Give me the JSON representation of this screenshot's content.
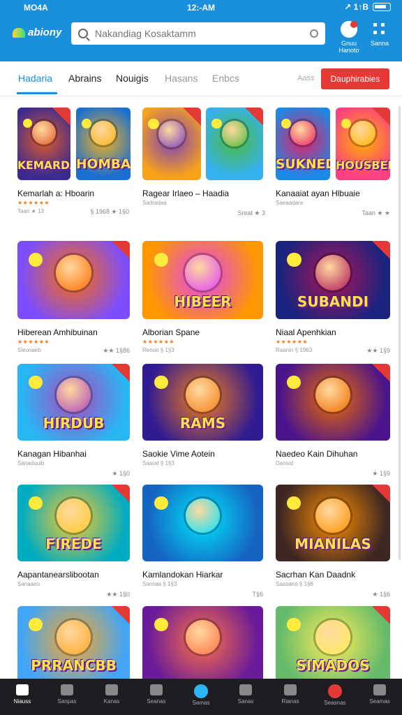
{
  "status": {
    "carrier": "MO4A",
    "time": "12:-AM",
    "signal": "↗︎ 1↑B"
  },
  "header": {
    "logo": "abiony",
    "search_placeholder": "Nakandiag Kosaktamm",
    "notifications_label": "Gnuu\nHanoto",
    "menu_label": "Sanna"
  },
  "tabs": [
    {
      "label": "Hadaria"
    },
    {
      "label": "Abrains"
    },
    {
      "label": "Nouigis"
    },
    {
      "label": "Hasans"
    },
    {
      "label": "Enbcs"
    }
  ],
  "tab_extra": "Aass",
  "cta_label": "Dauphirabies",
  "cards": [
    {
      "title": "Kemarlah a: Hboarin",
      "stars": "★★★★★★",
      "sub": "Taan ★ 13",
      "meta": "§ 1968 ★ 1§0",
      "art": "KEMARDA",
      "c1": "#3b2b8f",
      "c2": "#e05a2b"
    },
    {
      "title": "",
      "stars": "",
      "sub": "",
      "meta": "",
      "art": "HOMBAN",
      "c1": "#1b6fd1",
      "c2": "#f6b21a"
    },
    {
      "title": "Ragear Irlaeo – Haadia",
      "stars": "",
      "sub": "Sadradaa",
      "meta": "Sreat ★ 3",
      "art": "",
      "c1": "#f7a21b",
      "c2": "#7b3fbf"
    },
    {
      "title": "",
      "stars": "",
      "sub": "",
      "meta": "",
      "art": "",
      "c1": "#36b1f0",
      "c2": "#4cbb3b"
    },
    {
      "title": "Kanaaiat ayan Hlbuaie",
      "stars": "",
      "sub": "Saeaadara",
      "meta": "Taan ★ ★",
      "art": "SUKNED",
      "c1": "#1e88e5",
      "c2": "#e91e63"
    },
    {
      "title": "",
      "stars": "",
      "sub": "",
      "meta": "",
      "art": "HOUSBEN",
      "c1": "#ff4081",
      "c2": "#ffb300"
    },
    {
      "title": "Hiberean Amhibuinan",
      "stars": "★★★★★★",
      "sub": "Sleonaeb",
      "meta": "★★ 1§86",
      "art": "",
      "c1": "#7c4dff",
      "c2": "#ff6d00"
    },
    {
      "title": "Alborian Spane",
      "stars": "★★★★★★",
      "sub": "Rerion § 1§3",
      "meta": "",
      "art": "HIBEER",
      "c1": "#ff9800",
      "c2": "#e040fb"
    },
    {
      "title": "Niaal Apenhkian",
      "stars": "★★★★★★",
      "sub": "Raanin § 1963",
      "meta": "★★ 1§9",
      "art": "SUBANDI",
      "c1": "#1a237e",
      "c2": "#ad1457"
    },
    {
      "title": "Kanagan Hibanhai",
      "stars": "",
      "sub": "Sanaduuib",
      "meta": "★ 1§0",
      "art": "HIRDUB",
      "c1": "#29b6f6",
      "c2": "#ab47bc"
    },
    {
      "title": "Saokie Vime Aotein",
      "stars": "",
      "sub": "Saarat § 1§3",
      "meta": "",
      "art": "RAMS",
      "c1": "#311b92",
      "c2": "#f57f17"
    },
    {
      "title": "Naedeo Kain Dihuhan",
      "stars": "",
      "sub": "Dansid",
      "meta": "★ 1§9",
      "art": "",
      "c1": "#4a148c",
      "c2": "#ef6c00"
    },
    {
      "title": "Aapantanearslibootan",
      "stars": "",
      "sub": "Sanaaeo",
      "meta": "★★ 1§0",
      "art": "FIREDE",
      "c1": "#00acc1",
      "c2": "#ffca28"
    },
    {
      "title": "Kamlandokan Hiarkar",
      "stars": "",
      "sub": "Sansaa § 1§3",
      "meta": "T§6",
      "art": "",
      "c1": "#1565c0",
      "c2": "#00e5ff"
    },
    {
      "title": "Sacrhan Kan Daadnk",
      "stars": "",
      "sub": "Saasano § 1§6",
      "meta": "★ 1§6",
      "art": "MIANILAS",
      "c1": "#3e2723",
      "c2": "#ff8f00"
    },
    {
      "title": "",
      "stars": "",
      "sub": "",
      "meta": "",
      "art": "PRRANCBB",
      "c1": "#42a5f5",
      "c2": "#ffa726"
    },
    {
      "title": "",
      "stars": "",
      "sub": "",
      "meta": "",
      "art": "",
      "c1": "#6a1b9a",
      "c2": "#ff7043"
    },
    {
      "title": "",
      "stars": "",
      "sub": "",
      "meta": "",
      "art": "SIMADOS",
      "c1": "#66bb6a",
      "c2": "#ffee58"
    }
  ],
  "bottom_nav": [
    {
      "label": "Niauss",
      "active": true
    },
    {
      "label": "Sanpas"
    },
    {
      "label": "Kanas"
    },
    {
      "label": "Seanas"
    },
    {
      "label": "Samas"
    },
    {
      "label": "Sanas"
    },
    {
      "label": "Rianas"
    },
    {
      "label": "Seasnas"
    },
    {
      "label": "Seamas"
    }
  ]
}
